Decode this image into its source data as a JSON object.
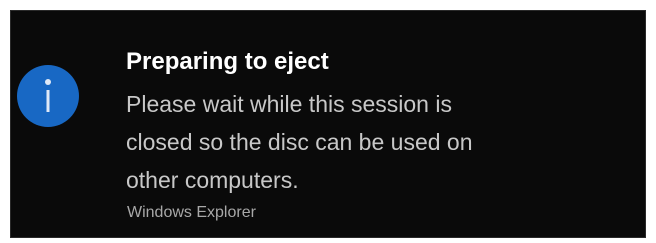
{
  "notification": {
    "icon": "info-icon",
    "icon_color": "#1868c4",
    "title": "Preparing to eject",
    "message_lines": [
      "Please wait while this session is",
      "closed so the disc can be used on",
      "other computers."
    ],
    "source": "Windows Explorer"
  }
}
